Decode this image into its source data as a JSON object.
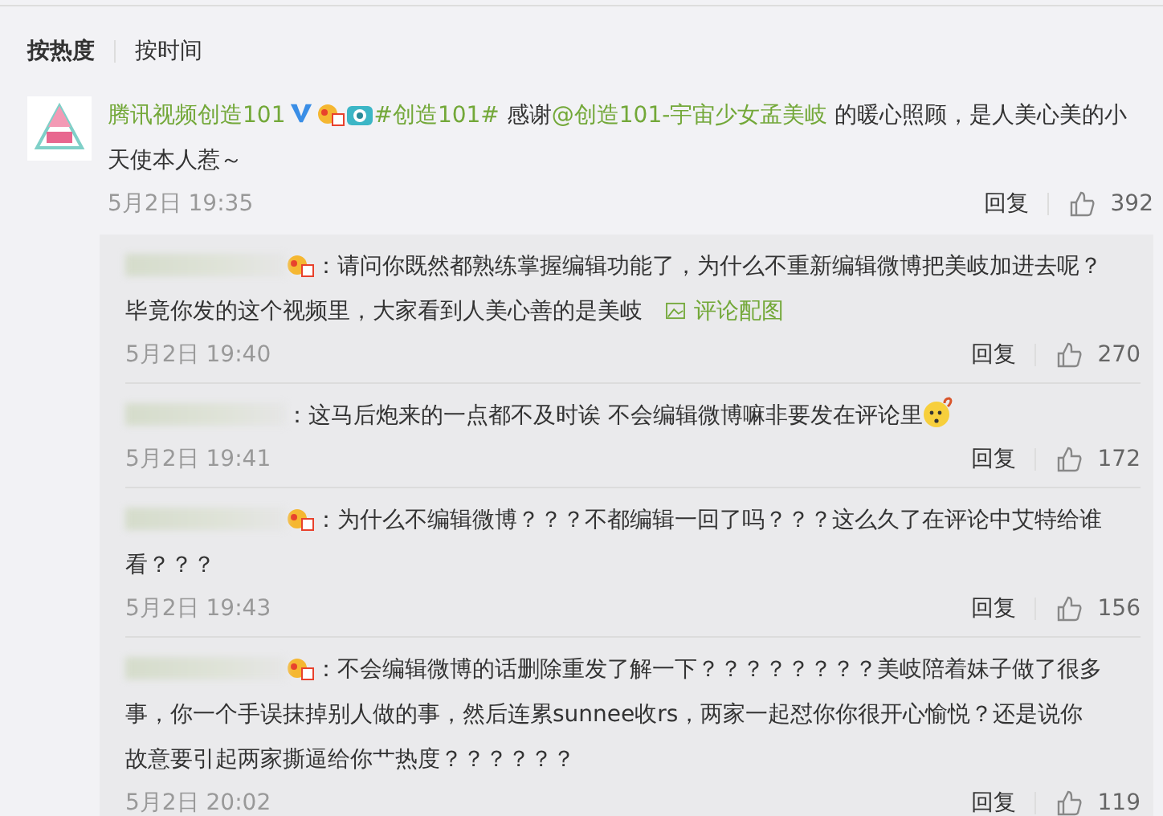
{
  "sort_tabs": [
    {
      "label": "按热度",
      "selected": true
    },
    {
      "label": "按时间",
      "selected": false
    }
  ],
  "post": {
    "author": "腾讯视频创造101",
    "verified": true,
    "segments": [
      {
        "kind": "link",
        "text": "#创造101#"
      },
      {
        "kind": "text",
        "text": " 感谢"
      },
      {
        "kind": "link",
        "text": "@创造101-宇宙少女孟美岐"
      },
      {
        "kind": "text",
        "text": " 的暖心照顾，是人美心美的小天使本人惹～"
      }
    ],
    "time": "5月2日 19:35",
    "reply_label": "回复",
    "likes": "392"
  },
  "replies": [
    {
      "badge": true,
      "text": "：请问你既然都熟练掌握编辑功能了，为什么不重新编辑微博把美岐加进去呢？毕竟你发的这个视频里，大家看到人美心善的是美岐",
      "image_link": "评论配图",
      "emoji": false,
      "time": "5月2日 19:40",
      "reply_label": "回复",
      "likes": "270"
    },
    {
      "badge": false,
      "text": "：这马后炮来的一点都不及时诶 不会编辑微博嘛非要发在评论里",
      "emoji": true,
      "time": "5月2日 19:41",
      "reply_label": "回复",
      "likes": "172"
    },
    {
      "badge": true,
      "text": "：为什么不编辑微博？？？不都编辑一回了吗？？？这么久了在评论中艾特给谁看？？？",
      "emoji": false,
      "time": "5月2日 19:43",
      "reply_label": "回复",
      "likes": "156"
    },
    {
      "badge": true,
      "text": "：不会编辑微博的话删除重发了解一下？？？？？？？？美岐陪着妹子做了很多事，你一个手误抹掉别人做的事，然后连累sunnee收rs，两家一起怼你你很开心愉悦？还是说你故意要引起两家撕逼给你艹热度？？？？？？",
      "emoji": false,
      "time": "5月2日 20:02",
      "reply_label": "回复",
      "likes": "119"
    }
  ]
}
